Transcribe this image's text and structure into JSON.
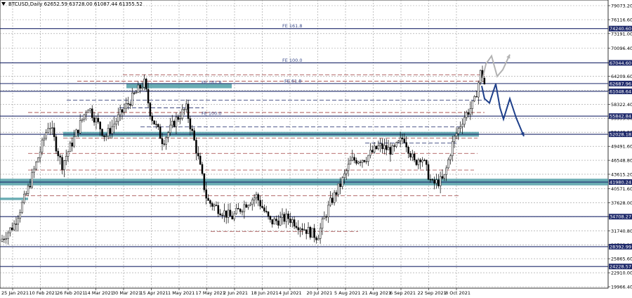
{
  "chart_data": {
    "type": "candlestick",
    "title": "BTCUSD,Daily  62652.59 63728.00 61087.44 61355.52",
    "ylim": [
      19966.4,
      79073.2
    ],
    "y_ticks": [
      "79073.20",
      "76116.60",
      "73191.00",
      "70096.40",
      "67044.80",
      "64209.60",
      "61253.00",
      "58322.40",
      "55395.80",
      "52440.20",
      "49491.60",
      "46548.80",
      "43615.20",
      "40571.60",
      "37628.00",
      "34701.40",
      "31740.80",
      "28792.20",
      "25865.60",
      "22910.00",
      "19966.40"
    ],
    "x_ticks": [
      "25 Jan 2021",
      "10 Feb 2021",
      "26 Feb 2021",
      "14 Mar 2021",
      "30 Mar 2021",
      "15 Apr 2021",
      "1 May 2021",
      "17 May 2021",
      "2 Jun 2021",
      "18 Jun 2021",
      "4 Jul 2021",
      "20 Jul 2021",
      "5 Aug 2021",
      "21 Aug 2021",
      "6 Sep 2021",
      "22 Sep 2021",
      "8 Oct 2021"
    ],
    "levels": [
      {
        "value": 74240.6,
        "label": "74240.60"
      },
      {
        "value": 67044.6,
        "label": "67044.60"
      },
      {
        "value": 62687.96,
        "label": "62687.96"
      },
      {
        "value": 61048.64,
        "label": "61048.64"
      },
      {
        "value": 55842.84,
        "label": "55842.84"
      },
      {
        "value": 52028.18,
        "label": "52028.18"
      },
      {
        "value": 41980.24,
        "label": "41980.24"
      },
      {
        "value": 34708.27,
        "label": "34708.27"
      },
      {
        "value": 28392.99,
        "label": "28392.99"
      },
      {
        "value": 24228.57,
        "label": "24228.57"
      }
    ],
    "fib_labels": [
      {
        "text": "FE 161.8",
        "value": 74240.6
      },
      {
        "text": "FE 100.0",
        "value": 67044.6
      },
      {
        "text": "FE 61.8",
        "value": 62687.96
      },
      {
        "text": "FE 161.8",
        "value": 62400
      },
      {
        "text": "FE 100.0",
        "value": 55842.84
      }
    ],
    "anchors": [
      {
        "x": 0,
        "price": 29500
      },
      {
        "x": 20,
        "price": 33000
      },
      {
        "x": 40,
        "price": 40500
      },
      {
        "x": 55,
        "price": 47500
      },
      {
        "x": 70,
        "price": 54500
      },
      {
        "x": 88,
        "price": 45500
      },
      {
        "x": 105,
        "price": 51000
      },
      {
        "x": 125,
        "price": 58000
      },
      {
        "x": 150,
        "price": 51500
      },
      {
        "x": 175,
        "price": 57000
      },
      {
        "x": 205,
        "price": 63000
      },
      {
        "x": 215,
        "price": 56000
      },
      {
        "x": 232,
        "price": 50500
      },
      {
        "x": 250,
        "price": 55000
      },
      {
        "x": 265,
        "price": 57500
      },
      {
        "x": 280,
        "price": 48500
      },
      {
        "x": 295,
        "price": 38000
      },
      {
        "x": 310,
        "price": 36500
      },
      {
        "x": 330,
        "price": 34500
      },
      {
        "x": 350,
        "price": 37500
      },
      {
        "x": 365,
        "price": 39000
      },
      {
        "x": 385,
        "price": 33500
      },
      {
        "x": 410,
        "price": 34500
      },
      {
        "x": 430,
        "price": 32500
      },
      {
        "x": 452,
        "price": 30500
      },
      {
        "x": 470,
        "price": 37500
      },
      {
        "x": 485,
        "price": 41500
      },
      {
        "x": 500,
        "price": 46500
      },
      {
        "x": 520,
        "price": 47000
      },
      {
        "x": 540,
        "price": 49500
      },
      {
        "x": 560,
        "price": 48500
      },
      {
        "x": 575,
        "price": 51500
      },
      {
        "x": 590,
        "price": 46000
      },
      {
        "x": 600,
        "price": 47500
      },
      {
        "x": 615,
        "price": 41500
      },
      {
        "x": 632,
        "price": 42500
      },
      {
        "x": 645,
        "price": 50500
      },
      {
        "x": 660,
        "price": 55500
      },
      {
        "x": 675,
        "price": 58500
      },
      {
        "x": 685,
        "price": 65500
      },
      {
        "x": 692,
        "price": 61300
      }
    ]
  }
}
